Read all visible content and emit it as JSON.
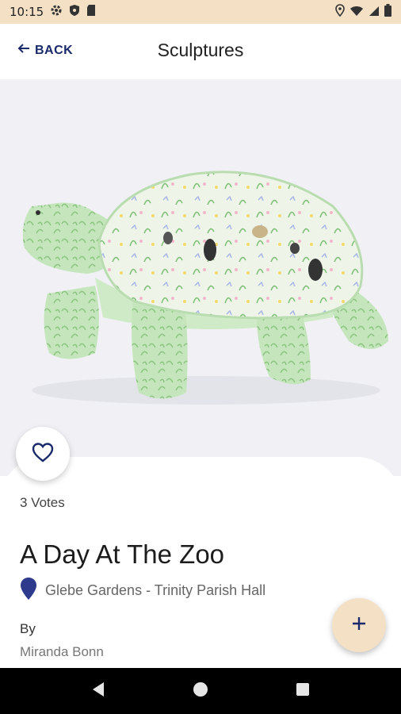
{
  "status_bar": {
    "time": "10:15",
    "left_icons": [
      "settings-icon",
      "shield-icon",
      "sd-card-icon"
    ],
    "right_icons": [
      "location-icon",
      "wifi-icon",
      "signal-icon",
      "battery-icon"
    ],
    "background_color": "#f4e0c4"
  },
  "app_bar": {
    "back_label": "BACK",
    "title": "Sculptures",
    "accent_color": "#1a2a6b"
  },
  "hero": {
    "image_subject": "painted tortoise sculpture"
  },
  "detail": {
    "votes": "3 Votes",
    "name": "A Day At The Zoo",
    "location": "Glebe Gardens - Trinity Parish Hall",
    "by_label": "By",
    "artist": "Miranda Bonn"
  },
  "fab": {
    "icon": "plus-icon",
    "color": "#f4e0c4"
  },
  "nav_bar": {
    "buttons": [
      "back-triangle-icon",
      "home-circle-icon",
      "recents-square-icon"
    ]
  }
}
